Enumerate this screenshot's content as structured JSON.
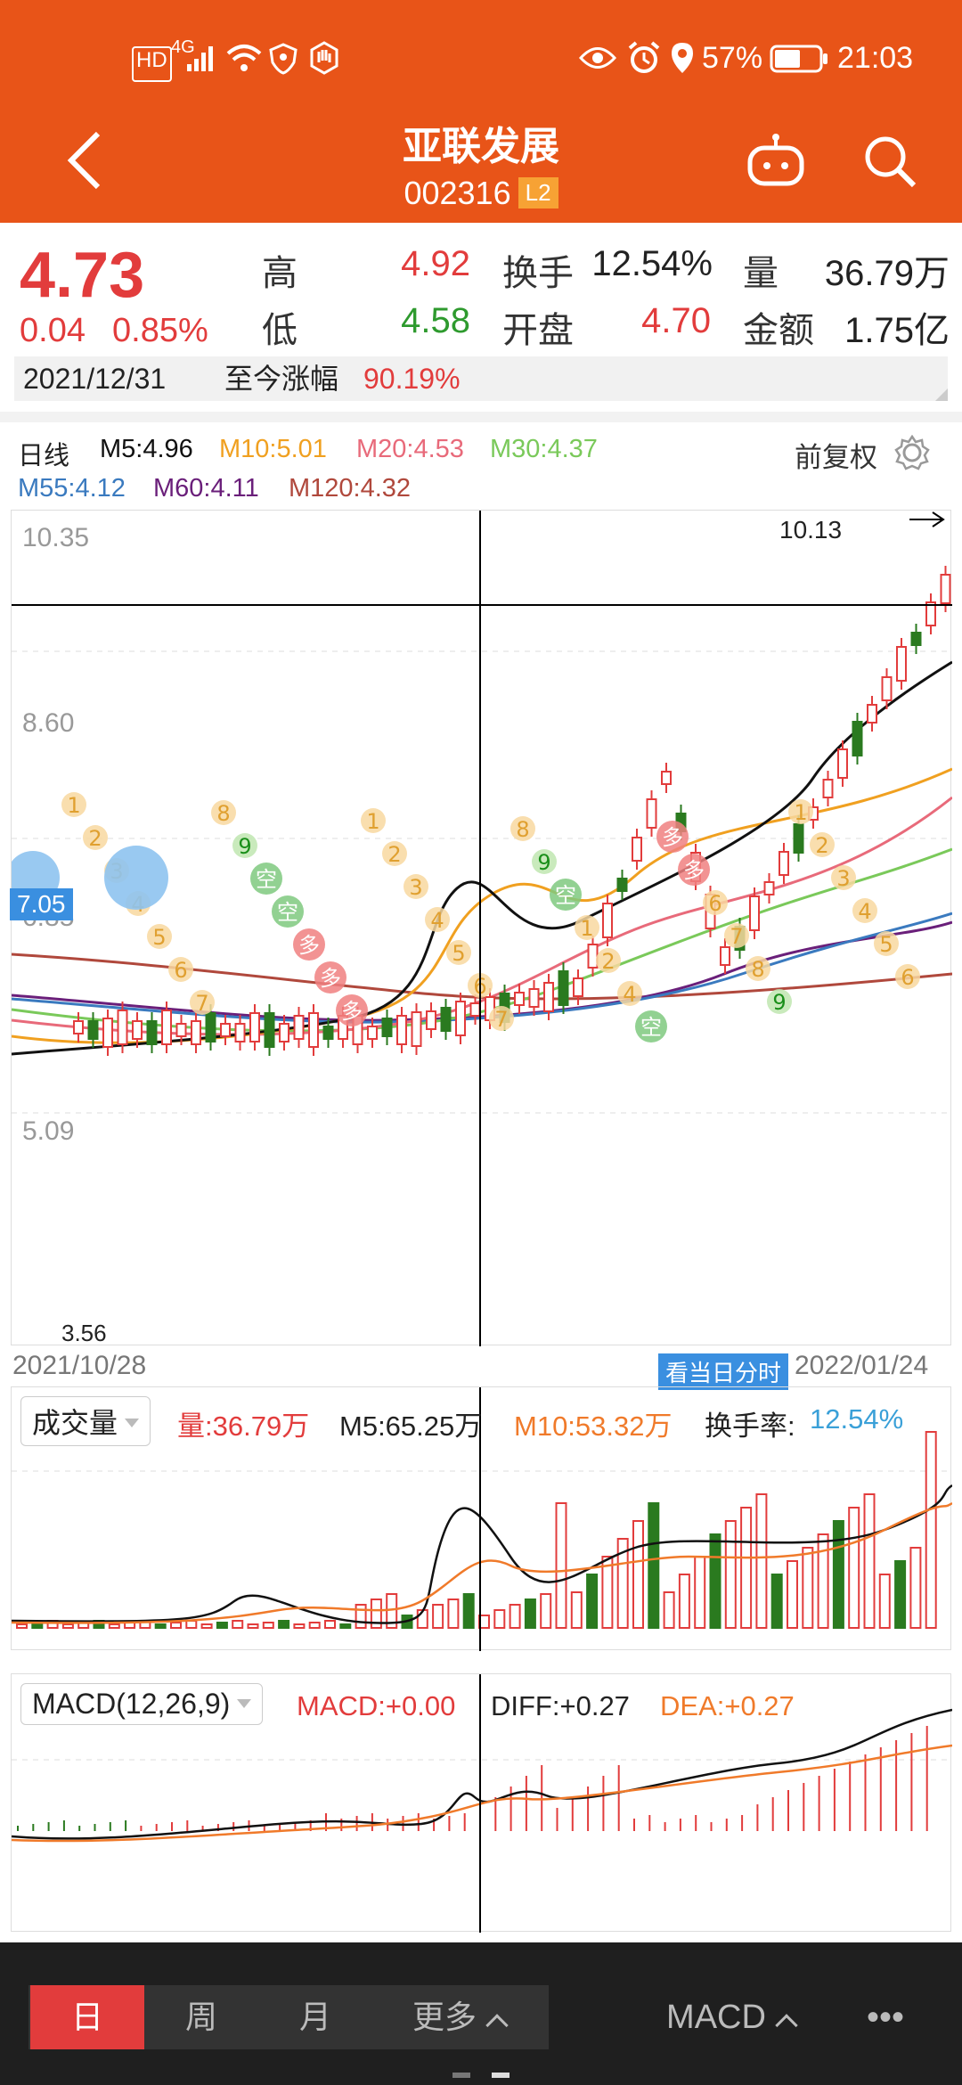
{
  "status_bar": {
    "left_badges": [
      "HD",
      "4G"
    ],
    "battery": "57%",
    "time": "21:03"
  },
  "header": {
    "title": "亚联发展",
    "code": "002316",
    "level_badge": "L2"
  },
  "quote": {
    "price": "4.73",
    "change": "0.04",
    "change_pct": "0.85%",
    "high_label": "高",
    "high": "4.92",
    "low_label": "低",
    "low": "4.58",
    "turnover_label": "换手",
    "turnover": "12.54%",
    "open_label": "开盘",
    "open": "4.70",
    "volume_label": "量",
    "volume": "36.79万",
    "amount_label": "金额",
    "amount": "1.75亿",
    "date": "2021/12/31",
    "since_label": "至今涨幅",
    "since_pct": "90.19%"
  },
  "ma_legend": {
    "period": "日线",
    "m5": "M5:4.96",
    "m10": "M10:5.01",
    "m20": "M20:4.53",
    "m30": "M30:4.37",
    "m55": "M55:4.12",
    "m60": "M60:4.11",
    "m120": "M120:4.32",
    "adjust": "前复权"
  },
  "kline": {
    "price_labels": [
      "10.35",
      "8.60",
      "6.85",
      "5.09"
    ],
    "cursor_price": "7.05",
    "max_label": "10.13",
    "min_label": "3.56",
    "start_date": "2021/10/28",
    "end_date": "2022/01/24",
    "intraday_btn": "看当日分时",
    "colors": {
      "up": "#e23c3c",
      "down": "#2a7a1f",
      "m5": "#111111",
      "m10": "#f0a020",
      "m20": "#e86a7a",
      "m30": "#7ac95a",
      "m55": "#3a7abf",
      "m60": "#6a1f7a",
      "m120": "#b0483c"
    },
    "marks": [
      {
        "text": "1",
        "type": "seq"
      },
      {
        "text": "2",
        "type": "seq"
      },
      {
        "text": "3",
        "type": "seq"
      },
      {
        "text": "4",
        "type": "seq"
      },
      {
        "text": "5",
        "type": "seq"
      },
      {
        "text": "6",
        "type": "seq"
      },
      {
        "text": "7",
        "type": "seq"
      },
      {
        "text": "8",
        "type": "seq"
      },
      {
        "text": "9",
        "type": "nine"
      },
      {
        "text": "空",
        "type": "short"
      },
      {
        "text": "空",
        "type": "short"
      },
      {
        "text": "多",
        "type": "long"
      },
      {
        "text": "多",
        "type": "long"
      },
      {
        "text": "多",
        "type": "long"
      },
      {
        "text": "1",
        "type": "seq"
      },
      {
        "text": "2",
        "type": "seq"
      },
      {
        "text": "3",
        "type": "seq"
      },
      {
        "text": "4",
        "type": "seq"
      },
      {
        "text": "5",
        "type": "seq"
      },
      {
        "text": "6",
        "type": "seq"
      },
      {
        "text": "7",
        "type": "seq"
      },
      {
        "text": "8",
        "type": "seq"
      },
      {
        "text": "9",
        "type": "nine"
      },
      {
        "text": "空",
        "type": "short"
      },
      {
        "text": "1",
        "type": "seq"
      },
      {
        "text": "2",
        "type": "seq"
      },
      {
        "text": "4",
        "type": "seq"
      },
      {
        "text": "空",
        "type": "short"
      },
      {
        "text": "多",
        "type": "long"
      },
      {
        "text": "多",
        "type": "long"
      },
      {
        "text": "6",
        "type": "seq"
      },
      {
        "text": "7",
        "type": "seq"
      },
      {
        "text": "8",
        "type": "seq"
      },
      {
        "text": "9",
        "type": "nine"
      },
      {
        "text": "1",
        "type": "seq"
      },
      {
        "text": "2",
        "type": "seq"
      },
      {
        "text": "3",
        "type": "seq"
      },
      {
        "text": "4",
        "type": "seq"
      },
      {
        "text": "5",
        "type": "seq"
      },
      {
        "text": "6",
        "type": "seq"
      }
    ]
  },
  "volume_panel": {
    "selector": "成交量",
    "vol": "量:36.79万",
    "m5": "M5:65.25万",
    "m10": "M10:53.32万",
    "turnover_label": "换手率:",
    "turnover": "12.54%"
  },
  "macd_panel": {
    "selector": "MACD(12,26,9)",
    "macd": "MACD:+0.00",
    "diff": "DIFF:+0.27",
    "dea": "DEA:+0.27"
  },
  "bottom_bar": {
    "tabs": [
      "日",
      "周",
      "月",
      "更多"
    ],
    "indicator": "MACD",
    "more": "•••"
  }
}
